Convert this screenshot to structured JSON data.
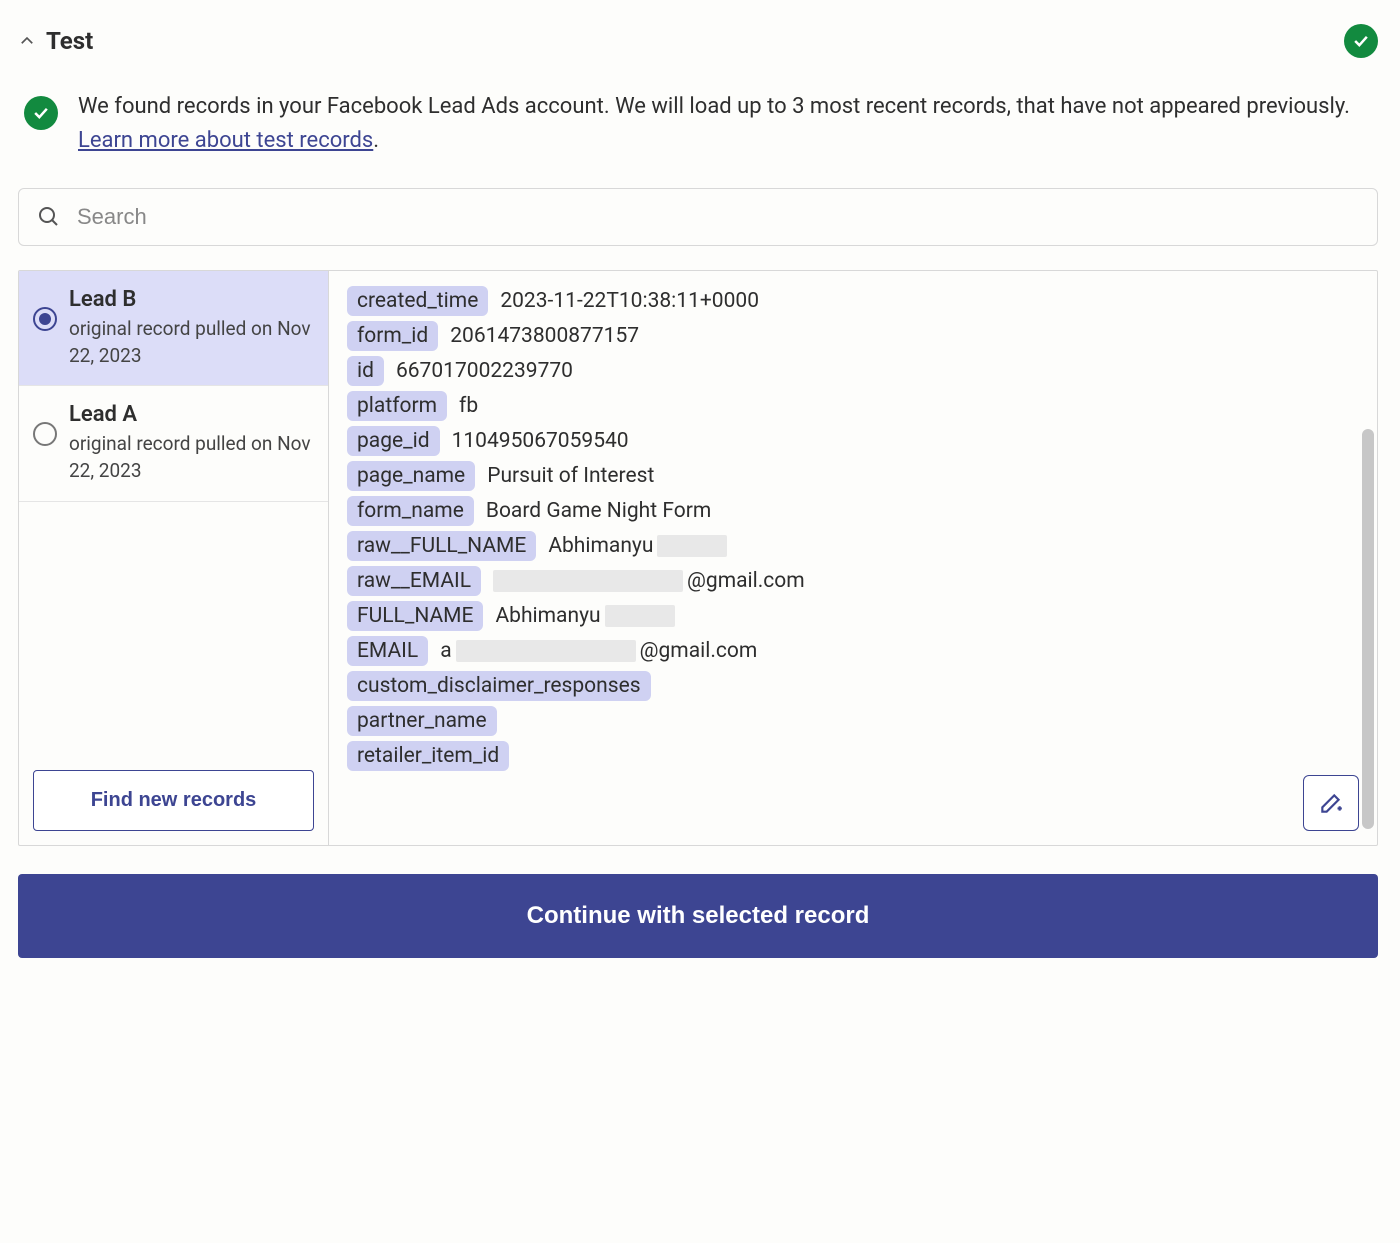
{
  "header": {
    "title": "Test"
  },
  "info": {
    "text": "We found records in your Facebook Lead Ads account. We will load up to 3 most recent records, that have not appeared previously. ",
    "link_text": "Learn more about test records",
    "after_link": "."
  },
  "search": {
    "placeholder": "Search"
  },
  "sidebar": {
    "records": [
      {
        "title": "Lead B",
        "subtitle": "original record pulled on Nov 22, 2023",
        "selected": true
      },
      {
        "title": "Lead A",
        "subtitle": "original record pulled on Nov 22, 2023",
        "selected": false
      }
    ],
    "find_label": "Find new records"
  },
  "details": {
    "fields": [
      {
        "key": "created_time",
        "value": "2023-11-22T10:38:11+0000"
      },
      {
        "key": "form_id",
        "value": "2061473800877157"
      },
      {
        "key": "id",
        "value": "667017002239770"
      },
      {
        "key": "platform",
        "value": "fb"
      },
      {
        "key": "page_id",
        "value": "110495067059540"
      },
      {
        "key": "page_name",
        "value": "Pursuit of Interest"
      },
      {
        "key": "form_name",
        "value": "Board Game Night Form"
      },
      {
        "key": "raw__FULL_NAME",
        "value_prefix": "Abhimanyu ",
        "redacted_width": 70,
        "value_suffix": ""
      },
      {
        "key": "raw__EMAIL",
        "value_prefix": "",
        "redacted_width": 190,
        "value_suffix": "@gmail.com"
      },
      {
        "key": "FULL_NAME",
        "value_prefix": "Abhimanyu ",
        "redacted_width": 70,
        "value_suffix": ""
      },
      {
        "key": "EMAIL",
        "value_prefix": "a",
        "redacted_width": 180,
        "value_suffix": "@gmail.com"
      },
      {
        "key": "custom_disclaimer_responses",
        "value": ""
      },
      {
        "key": "partner_name",
        "value": ""
      },
      {
        "key": "retailer_item_id",
        "value": ""
      }
    ]
  },
  "continue_label": "Continue with selected record"
}
